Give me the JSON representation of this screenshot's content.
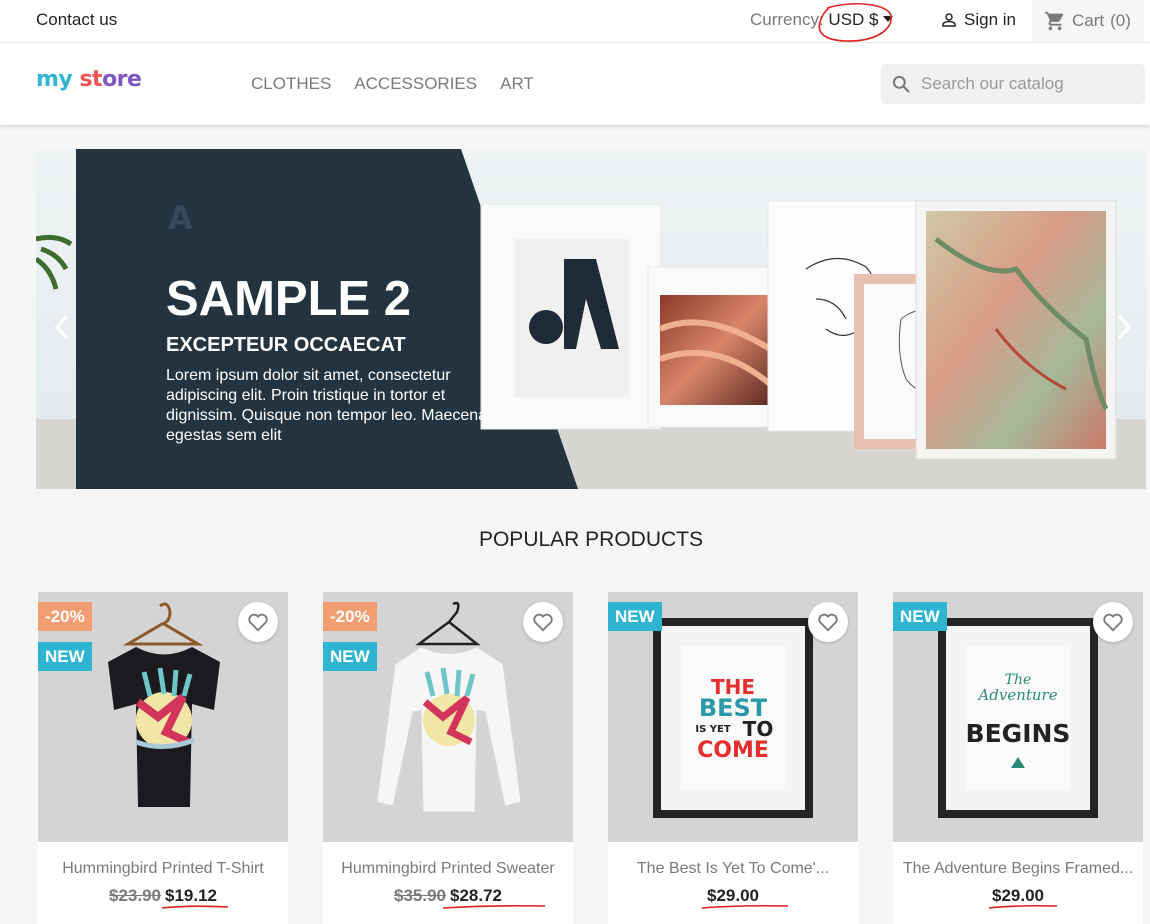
{
  "topbar": {
    "contact": "Contact us",
    "currency_label": "Currency:",
    "currency_value": "USD $",
    "signin": "Sign in",
    "cart": "Cart",
    "cart_count": "(0)"
  },
  "header": {
    "logo": {
      "part1": "my",
      "part2": "st",
      "part3": "ore"
    },
    "nav": [
      "CLOTHES",
      "ACCESSORIES",
      "ART"
    ],
    "search_placeholder": "Search our catalog"
  },
  "hero": {
    "title": "SAMPLE 2",
    "subtitle": "EXCEPTEUR OCCAECAT",
    "text": "Lorem ipsum dolor sit amet, consectetur adipiscing elit. Proin tristique in tortor et dignissim. Quisque non tempor leo. Maecenas egestas sem elit"
  },
  "section_title": "POPULAR PRODUCTS",
  "products": [
    {
      "name": "Hummingbird Printed T-Shirt",
      "discount": "-20%",
      "flag_new": "NEW",
      "regular_price": "$23.90",
      "price": "$19.12"
    },
    {
      "name": "Hummingbird Printed Sweater",
      "discount": "-20%",
      "flag_new": "NEW",
      "regular_price": "$35.90",
      "price": "$28.72"
    },
    {
      "name": "The Best Is Yet To Come'...",
      "flag_new": "NEW",
      "price": "$29.00"
    },
    {
      "name": "The Adventure Begins Framed...",
      "flag_new": "NEW",
      "price": "$29.00"
    }
  ],
  "poster1": {
    "line1": "THE",
    "line2": "BEST",
    "line3": "IS YET",
    "line4": "TO",
    "line5": "COME"
  },
  "poster2": {
    "line1": "The",
    "line2": "Adventure",
    "line3": "BEGINS"
  },
  "colors": {
    "accent": "#2fb5d2",
    "discount": "#f39d72",
    "annotation": "#e0201e",
    "hero_dark": "#233440"
  }
}
